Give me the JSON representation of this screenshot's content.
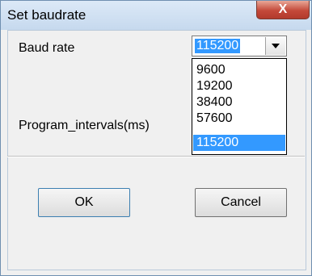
{
  "window": {
    "title": "Set baudrate",
    "close_symbol": "X",
    "close_icon": "close-icon"
  },
  "form": {
    "baud_label": "Baud rate",
    "program_label": "Program_intervals(ms)"
  },
  "baud_combo": {
    "selected": "115200",
    "arrow_icon": "chevron-down-icon",
    "options": [
      "9600",
      "19200",
      "38400",
      "57600",
      "115200"
    ]
  },
  "buttons": {
    "ok": "OK",
    "cancel": "Cancel"
  },
  "colors": {
    "selection": "#3399ff",
    "dialog_bg": "#f0f0f0",
    "close_button": "#c4493a"
  }
}
